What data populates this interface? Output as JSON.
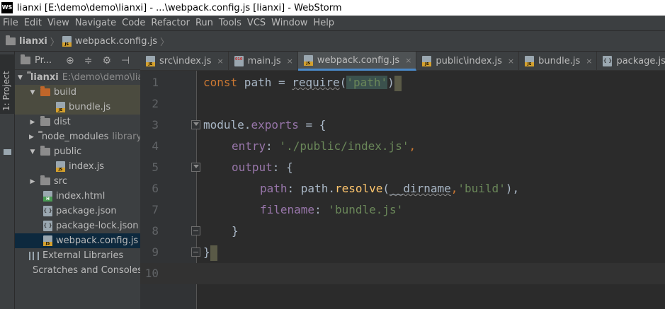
{
  "window": {
    "app_icon": "WS",
    "title": "lianxi [E:\\demo\\demo\\lianxi] - ...\\webpack.config.js [lianxi] - WebStorm"
  },
  "menu": [
    "File",
    "Edit",
    "View",
    "Navigate",
    "Code",
    "Refactor",
    "Run",
    "Tools",
    "VCS",
    "Window",
    "Help"
  ],
  "breadcrumb": {
    "project": "lianxi",
    "file": "webpack.config.js",
    "sep": "〉"
  },
  "tool_window": {
    "tab_label": "1: Project",
    "panel_title": "Pr...",
    "tools": [
      "settings-target-icon",
      "collapse-icon",
      "gear-icon",
      "hide-icon"
    ]
  },
  "tree": [
    {
      "label": "lianxi",
      "path": "E:\\demo\\demo\\lianxi",
      "icon": "folder-icon",
      "expanded": true
    },
    {
      "label": "build",
      "icon": "folder-orange-icon",
      "expanded": true
    },
    {
      "label": "bundle.js",
      "icon": "js-file-icon"
    },
    {
      "label": "dist",
      "icon": "folder-icon",
      "expanded": false
    },
    {
      "label": "node_modules",
      "suffix": "library root",
      "icon": "folder-icon",
      "expanded": false
    },
    {
      "label": "public",
      "icon": "folder-icon",
      "expanded": true
    },
    {
      "label": "index.js",
      "icon": "js-file-icon"
    },
    {
      "label": "src",
      "icon": "folder-icon",
      "expanded": false
    },
    {
      "label": "index.html",
      "icon": "html-file-icon"
    },
    {
      "label": "package.json",
      "icon": "json-file-icon"
    },
    {
      "label": "package-lock.json",
      "icon": "json-file-icon"
    },
    {
      "label": "webpack.config.js",
      "icon": "js-file-icon",
      "selected": true
    },
    {
      "label": "External Libraries",
      "icon": "library-icon"
    },
    {
      "label": "Scratches and Consoles",
      "icon": "scratch-icon"
    }
  ],
  "tabs": [
    {
      "label": "src\\index.js",
      "icon": "js-file-icon"
    },
    {
      "label": "main.js",
      "icon": "binary-file-icon"
    },
    {
      "label": "webpack.config.js",
      "icon": "js-file-icon",
      "active": true
    },
    {
      "label": "public\\index.js",
      "icon": "js-file-icon"
    },
    {
      "label": "bundle.js",
      "icon": "js-file-icon"
    },
    {
      "label": "package.json",
      "icon": "json-file-icon"
    }
  ],
  "tab_close": "×",
  "editor": {
    "line_numbers": [
      "1",
      "2",
      "3",
      "4",
      "5",
      "6",
      "7",
      "8",
      "9",
      "10"
    ],
    "code": {
      "l1_kw": "const",
      "l1_var": " path = ",
      "l1_fn": "require",
      "l1_open": "(",
      "l1_str": "'path'",
      "l1_close": ")",
      "l3_a": "module",
      "l3_dot": ".",
      "l3_b": "exports",
      "l3_c": " = {",
      "l4_key": "entry",
      "l4_colon": ": ",
      "l4_str": "'./public/index.js'",
      "l4_comma": ",",
      "l5_key": "output",
      "l5_rest": ": {",
      "l6_key": "path",
      "l6_colon": ": ",
      "l6_obj": "path.",
      "l6_fn": "resolve",
      "l6_open": "(",
      "l6_dirname": "__dirname",
      "l6_comma": ",",
      "l6_str": "'build'",
      "l6_close": "),",
      "l7_key": "filename",
      "l7_colon": ": ",
      "l7_str": "'bundle.js'",
      "l8": "}",
      "l9": "}"
    }
  },
  "colors": {
    "editor_bg": "#2b2b2b",
    "panel_bg": "#3c3f41",
    "keyword": "#cc7832",
    "string": "#6a8759",
    "property": "#9876aa",
    "function": "#ffc66d",
    "selection": "#0d293e"
  }
}
